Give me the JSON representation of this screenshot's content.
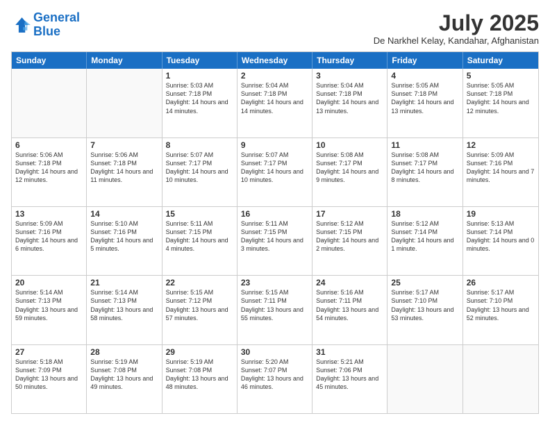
{
  "logo": {
    "line1": "General",
    "line2": "Blue"
  },
  "title": "July 2025",
  "location": "De Narkhel Kelay, Kandahar, Afghanistan",
  "days_of_week": [
    "Sunday",
    "Monday",
    "Tuesday",
    "Wednesday",
    "Thursday",
    "Friday",
    "Saturday"
  ],
  "weeks": [
    [
      {
        "day": "",
        "empty": true
      },
      {
        "day": "",
        "empty": true
      },
      {
        "day": "1",
        "sunrise": "5:03 AM",
        "sunset": "7:18 PM",
        "daylight": "14 hours and 14 minutes."
      },
      {
        "day": "2",
        "sunrise": "5:04 AM",
        "sunset": "7:18 PM",
        "daylight": "14 hours and 14 minutes."
      },
      {
        "day": "3",
        "sunrise": "5:04 AM",
        "sunset": "7:18 PM",
        "daylight": "14 hours and 13 minutes."
      },
      {
        "day": "4",
        "sunrise": "5:05 AM",
        "sunset": "7:18 PM",
        "daylight": "14 hours and 13 minutes."
      },
      {
        "day": "5",
        "sunrise": "5:05 AM",
        "sunset": "7:18 PM",
        "daylight": "14 hours and 12 minutes."
      }
    ],
    [
      {
        "day": "6",
        "sunrise": "5:06 AM",
        "sunset": "7:18 PM",
        "daylight": "14 hours and 12 minutes."
      },
      {
        "day": "7",
        "sunrise": "5:06 AM",
        "sunset": "7:18 PM",
        "daylight": "14 hours and 11 minutes."
      },
      {
        "day": "8",
        "sunrise": "5:07 AM",
        "sunset": "7:17 PM",
        "daylight": "14 hours and 10 minutes."
      },
      {
        "day": "9",
        "sunrise": "5:07 AM",
        "sunset": "7:17 PM",
        "daylight": "14 hours and 10 minutes."
      },
      {
        "day": "10",
        "sunrise": "5:08 AM",
        "sunset": "7:17 PM",
        "daylight": "14 hours and 9 minutes."
      },
      {
        "day": "11",
        "sunrise": "5:08 AM",
        "sunset": "7:17 PM",
        "daylight": "14 hours and 8 minutes."
      },
      {
        "day": "12",
        "sunrise": "5:09 AM",
        "sunset": "7:16 PM",
        "daylight": "14 hours and 7 minutes."
      }
    ],
    [
      {
        "day": "13",
        "sunrise": "5:09 AM",
        "sunset": "7:16 PM",
        "daylight": "14 hours and 6 minutes."
      },
      {
        "day": "14",
        "sunrise": "5:10 AM",
        "sunset": "7:16 PM",
        "daylight": "14 hours and 5 minutes."
      },
      {
        "day": "15",
        "sunrise": "5:11 AM",
        "sunset": "7:15 PM",
        "daylight": "14 hours and 4 minutes."
      },
      {
        "day": "16",
        "sunrise": "5:11 AM",
        "sunset": "7:15 PM",
        "daylight": "14 hours and 3 minutes."
      },
      {
        "day": "17",
        "sunrise": "5:12 AM",
        "sunset": "7:15 PM",
        "daylight": "14 hours and 2 minutes."
      },
      {
        "day": "18",
        "sunrise": "5:12 AM",
        "sunset": "7:14 PM",
        "daylight": "14 hours and 1 minute."
      },
      {
        "day": "19",
        "sunrise": "5:13 AM",
        "sunset": "7:14 PM",
        "daylight": "14 hours and 0 minutes."
      }
    ],
    [
      {
        "day": "20",
        "sunrise": "5:14 AM",
        "sunset": "7:13 PM",
        "daylight": "13 hours and 59 minutes."
      },
      {
        "day": "21",
        "sunrise": "5:14 AM",
        "sunset": "7:13 PM",
        "daylight": "13 hours and 58 minutes."
      },
      {
        "day": "22",
        "sunrise": "5:15 AM",
        "sunset": "7:12 PM",
        "daylight": "13 hours and 57 minutes."
      },
      {
        "day": "23",
        "sunrise": "5:15 AM",
        "sunset": "7:11 PM",
        "daylight": "13 hours and 55 minutes."
      },
      {
        "day": "24",
        "sunrise": "5:16 AM",
        "sunset": "7:11 PM",
        "daylight": "13 hours and 54 minutes."
      },
      {
        "day": "25",
        "sunrise": "5:17 AM",
        "sunset": "7:10 PM",
        "daylight": "13 hours and 53 minutes."
      },
      {
        "day": "26",
        "sunrise": "5:17 AM",
        "sunset": "7:10 PM",
        "daylight": "13 hours and 52 minutes."
      }
    ],
    [
      {
        "day": "27",
        "sunrise": "5:18 AM",
        "sunset": "7:09 PM",
        "daylight": "13 hours and 50 minutes."
      },
      {
        "day": "28",
        "sunrise": "5:19 AM",
        "sunset": "7:08 PM",
        "daylight": "13 hours and 49 minutes."
      },
      {
        "day": "29",
        "sunrise": "5:19 AM",
        "sunset": "7:08 PM",
        "daylight": "13 hours and 48 minutes."
      },
      {
        "day": "30",
        "sunrise": "5:20 AM",
        "sunset": "7:07 PM",
        "daylight": "13 hours and 46 minutes."
      },
      {
        "day": "31",
        "sunrise": "5:21 AM",
        "sunset": "7:06 PM",
        "daylight": "13 hours and 45 minutes."
      },
      {
        "day": "",
        "empty": true
      },
      {
        "day": "",
        "empty": true
      }
    ]
  ]
}
